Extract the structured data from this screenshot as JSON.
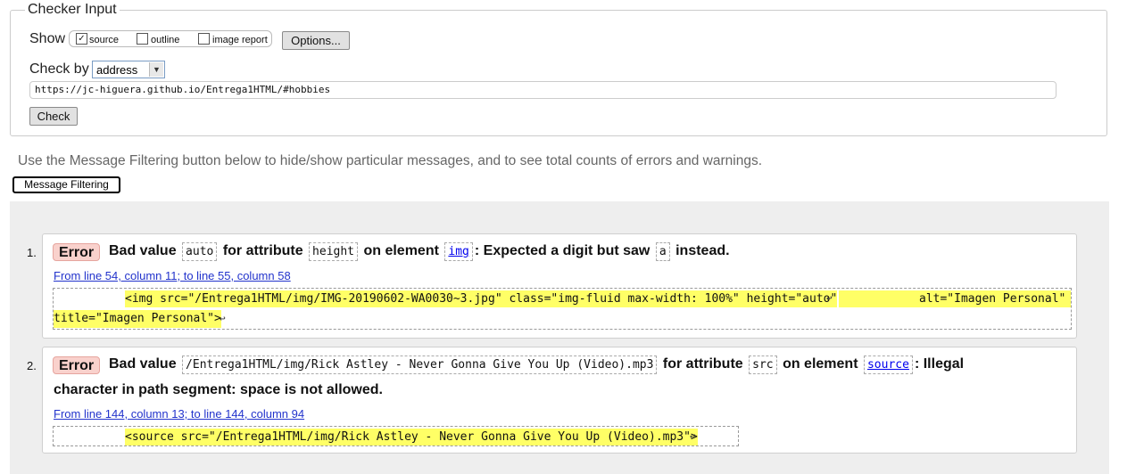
{
  "checker": {
    "legend": "Checker Input",
    "show_label": "Show",
    "options": [
      {
        "label": "source",
        "checked": true
      },
      {
        "label": "outline",
        "checked": false
      },
      {
        "label": "image report",
        "checked": false
      }
    ],
    "options_button": "Options...",
    "check_by_label": "Check by",
    "check_by_value": "address",
    "url": "https://jc-higuera.github.io/Entrega1HTML/#hobbies",
    "check_button": "Check"
  },
  "filter_note": "Use the Message Filtering button below to hide/show particular messages, and to see total counts of errors and warnings.",
  "filter_button": "Message Filtering",
  "messages": [
    {
      "number": "1.",
      "type": "Error",
      "parts": {
        "p1": "Bad value",
        "c1": "auto",
        "p2": "for attribute",
        "c2": "height",
        "p3": "on element",
        "c3": "img",
        "p4": ": Expected a digit but saw",
        "c4": "a",
        "p5": "instead."
      },
      "location": "From line 54, column 11; to line 55, column 58",
      "extract_line1": "<img src=\"/Entrega1HTML/img/IMG-20190602-WA0030~3.jpg\" class=\"img-fluid max-width: 100%\" height=\"auto\"",
      "extract_line1_after": "alt=\"Imagen Personal\"",
      "extract_line2": "title=\"Imagen Personal\">",
      "return_glyph": "↩"
    },
    {
      "number": "2.",
      "type": "Error",
      "parts": {
        "p1": "Bad value",
        "c1": "/Entrega1HTML/img/Rick Astley - Never Gonna Give You Up (Video).mp3",
        "p2": "for attribute",
        "c2": "src",
        "p3": "on element",
        "c3": "source",
        "p4": ": Illegal",
        "p5": "character in path segment: space is not allowed."
      },
      "location": "From line 144, column 13; to line 144, column 94",
      "extract_line1": "<source src=\"/Entrega1HTML/img/Rick Astley - Never Gonna Give You Up (Video).mp3\">",
      "return_glyph": "↩"
    }
  ]
}
